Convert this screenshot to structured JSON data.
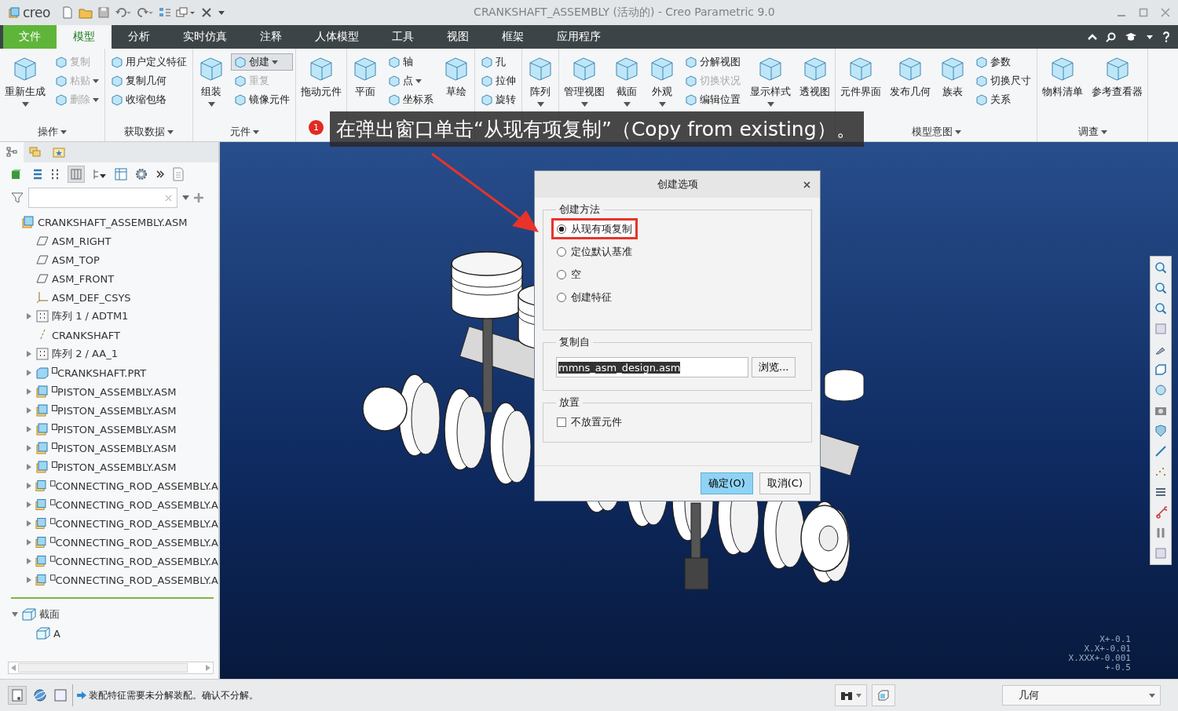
{
  "window": {
    "logo": "creo",
    "title": "CRANKSHAFT_ASSEMBLY (活动的) - Creo Parametric 9.0"
  },
  "ribbon_tabs": [
    {
      "label": "文件",
      "kind": "file",
      "selected": false
    },
    {
      "label": "模型",
      "kind": "tab",
      "selected": true
    },
    {
      "label": "分析",
      "kind": "tab",
      "selected": false
    },
    {
      "label": "实时仿真",
      "kind": "tab",
      "selected": false
    },
    {
      "label": "注释",
      "kind": "tab",
      "selected": false
    },
    {
      "label": "人体模型",
      "kind": "tab",
      "selected": false
    },
    {
      "label": "工具",
      "kind": "tab",
      "selected": false
    },
    {
      "label": "视图",
      "kind": "tab",
      "selected": false
    },
    {
      "label": "框架",
      "kind": "tab",
      "selected": false
    },
    {
      "label": "应用程序",
      "kind": "tab",
      "selected": false
    }
  ],
  "ribbon_groups": [
    {
      "label": "操作",
      "items": [
        {
          "label": "重新生成",
          "kind": "large",
          "dropdown": true,
          "disabled": false
        },
        {
          "label": "复制",
          "kind": "small",
          "dropdown": false,
          "disabled": true
        },
        {
          "label": "粘贴",
          "kind": "small",
          "dropdown": true,
          "disabled": true
        },
        {
          "label": "删除",
          "kind": "small",
          "dropdown": true,
          "disabled": true
        }
      ]
    },
    {
      "label": "获取数据",
      "items": [
        {
          "label": "用户定义特征",
          "kind": "small",
          "dropdown": false,
          "disabled": false
        },
        {
          "label": "复制几何",
          "kind": "small",
          "dropdown": false,
          "disabled": false
        },
        {
          "label": "收缩包络",
          "kind": "small",
          "dropdown": false,
          "disabled": false
        }
      ]
    },
    {
      "label": "元件",
      "items": [
        {
          "label": "组装",
          "kind": "large",
          "dropdown": true,
          "disabled": false
        },
        {
          "label": "创建",
          "kind": "small",
          "dropdown": true,
          "disabled": false,
          "pressed": true
        },
        {
          "label": "重复",
          "kind": "small",
          "dropdown": false,
          "disabled": true
        },
        {
          "label": "镜像元件",
          "kind": "small",
          "dropdown": false,
          "disabled": false
        }
      ]
    },
    {
      "items": [
        {
          "label": "拖动元件",
          "kind": "large",
          "dropdown": false,
          "disabled": false
        }
      ]
    },
    {
      "items": [
        {
          "label": "平面",
          "kind": "large",
          "dropdown": false,
          "disabled": false
        },
        {
          "label": "轴",
          "kind": "small",
          "dropdown": false,
          "disabled": false
        },
        {
          "label": "点",
          "kind": "small",
          "dropdown": true,
          "disabled": false
        },
        {
          "label": "坐标系",
          "kind": "small",
          "dropdown": false,
          "disabled": false
        },
        {
          "label": "草绘",
          "kind": "large",
          "dropdown": false,
          "disabled": false
        }
      ]
    },
    {
      "items": [
        {
          "label": "孔",
          "kind": "small",
          "dropdown": false,
          "disabled": false
        },
        {
          "label": "拉伸",
          "kind": "small",
          "dropdown": false,
          "disabled": false
        },
        {
          "label": "旋转",
          "kind": "small",
          "dropdown": false,
          "disabled": false
        }
      ]
    },
    {
      "items": [
        {
          "label": "阵列",
          "kind": "large",
          "dropdown": true,
          "disabled": false
        }
      ]
    },
    {
      "items": [
        {
          "label": "管理视图",
          "kind": "large",
          "dropdown": true,
          "disabled": false
        },
        {
          "label": "截面",
          "kind": "large",
          "dropdown": true,
          "disabled": false
        },
        {
          "label": "外观",
          "kind": "large",
          "dropdown": true,
          "disabled": false
        },
        {
          "label": "分解视图",
          "kind": "small",
          "dropdown": false,
          "disabled": false
        },
        {
          "label": "切换状况",
          "kind": "small",
          "dropdown": false,
          "disabled": true
        },
        {
          "label": "编辑位置",
          "kind": "small",
          "dropdown": false,
          "disabled": false
        },
        {
          "label": "显示样式",
          "kind": "large",
          "dropdown": true,
          "disabled": false
        },
        {
          "label": "透视图",
          "kind": "large",
          "dropdown": false,
          "disabled": false
        }
      ]
    },
    {
      "label": "模型意图",
      "items": [
        {
          "label": "元件界面",
          "kind": "large",
          "dropdown": false,
          "disabled": false
        },
        {
          "label": "发布几何",
          "kind": "large",
          "dropdown": false,
          "disabled": false
        },
        {
          "label": "族表",
          "kind": "large",
          "dropdown": false,
          "disabled": false
        },
        {
          "label": "参数",
          "kind": "small",
          "dropdown": false,
          "disabled": false
        },
        {
          "label": "切换尺寸",
          "kind": "small",
          "dropdown": false,
          "disabled": false
        },
        {
          "label": "关系",
          "kind": "small",
          "dropdown": false,
          "disabled": false
        }
      ]
    },
    {
      "label": "调查",
      "items": [
        {
          "label": "物料清单",
          "kind": "large",
          "dropdown": false,
          "disabled": false
        },
        {
          "label": "参考查看器",
          "kind": "large",
          "dropdown": false,
          "disabled": false
        }
      ]
    }
  ],
  "annotation": {
    "step": "1",
    "text": "在弹出窗口单击“从现有项复制”（Copy from existing）。"
  },
  "model_tree": {
    "tabs": [
      {
        "selected": true
      },
      {
        "selected": false
      },
      {
        "selected": false
      }
    ],
    "items": [
      {
        "label": "CRANKSHAFT_ASSEMBLY.ASM",
        "kind": "asm",
        "children": [
          {
            "label": "ASM_RIGHT",
            "kind": "plane"
          },
          {
            "label": "ASM_TOP",
            "kind": "plane"
          },
          {
            "label": "ASM_FRONT",
            "kind": "plane"
          },
          {
            "label": "ASM_DEF_CSYS",
            "kind": "csys"
          },
          {
            "label": "阵列 1 / ADTM1",
            "kind": "pattern",
            "expanded": false
          },
          {
            "label": "CRANKSHAFT",
            "kind": "axis"
          },
          {
            "label": "阵列 2 / AA_1",
            "kind": "pattern",
            "expanded": false
          },
          {
            "label": "CRANKSHAFT.PRT",
            "kind": "part",
            "expanded": false,
            "marker": true
          },
          {
            "label": "PISTON_ASSEMBLY.ASM",
            "kind": "asm",
            "expanded": false,
            "marker": true
          },
          {
            "label": "PISTON_ASSEMBLY.ASM",
            "kind": "asm",
            "expanded": false,
            "marker": true
          },
          {
            "label": "PISTON_ASSEMBLY.ASM",
            "kind": "asm",
            "expanded": false,
            "marker": true
          },
          {
            "label": "PISTON_ASSEMBLY.ASM",
            "kind": "asm",
            "expanded": false,
            "marker": true
          },
          {
            "label": "PISTON_ASSEMBLY.ASM",
            "kind": "asm",
            "expanded": false,
            "marker": true
          },
          {
            "label": "CONNECTING_ROD_ASSEMBLY.A",
            "kind": "asm",
            "expanded": false,
            "marker": true
          },
          {
            "label": "CONNECTING_ROD_ASSEMBLY.A",
            "kind": "asm",
            "expanded": false,
            "marker": true
          },
          {
            "label": "CONNECTING_ROD_ASSEMBLY.A",
            "kind": "asm",
            "expanded": false,
            "marker": true
          },
          {
            "label": "CONNECTING_ROD_ASSEMBLY.A",
            "kind": "asm",
            "expanded": false,
            "marker": true
          },
          {
            "label": "CONNECTING_ROD_ASSEMBLY.A",
            "kind": "asm",
            "expanded": false,
            "marker": true
          },
          {
            "label": "CONNECTING_ROD_ASSEMBLY.A",
            "kind": "asm",
            "expanded": false,
            "marker": true
          }
        ]
      }
    ],
    "sections": [
      {
        "label": "截面",
        "kind": "section",
        "expanded": true,
        "children": [
          {
            "label": "A",
            "kind": "section"
          }
        ]
      }
    ]
  },
  "viewport": {
    "tolerances": [
      "X+-0.1",
      "X.X+-0.01",
      "X.XXX+-0.001",
      "+-0.5"
    ]
  },
  "dialog": {
    "title": "创建选项",
    "method": {
      "legend": "创建方法",
      "options": [
        {
          "label": "从现有项复制",
          "selected": true,
          "highlighted": true
        },
        {
          "label": "定位默认基准",
          "selected": false,
          "highlighted": false
        },
        {
          "label": "空",
          "selected": false,
          "highlighted": false
        },
        {
          "label": "创建特征",
          "selected": false,
          "highlighted": false
        }
      ]
    },
    "copy_from": {
      "legend": "复制自",
      "value": "mmns_asm_design.asm",
      "value_selected": true,
      "browse": "浏览..."
    },
    "placement": {
      "legend": "放置",
      "checkbox": {
        "label": "不放置元件",
        "checked": false
      }
    },
    "buttons": [
      {
        "label": "确定(O)",
        "kind": "primary"
      },
      {
        "label": "取消(C)",
        "kind": "normal"
      }
    ]
  },
  "status_bar": {
    "message": "装配特征需要未分解装配。确认不分解。",
    "filter": "几何"
  }
}
